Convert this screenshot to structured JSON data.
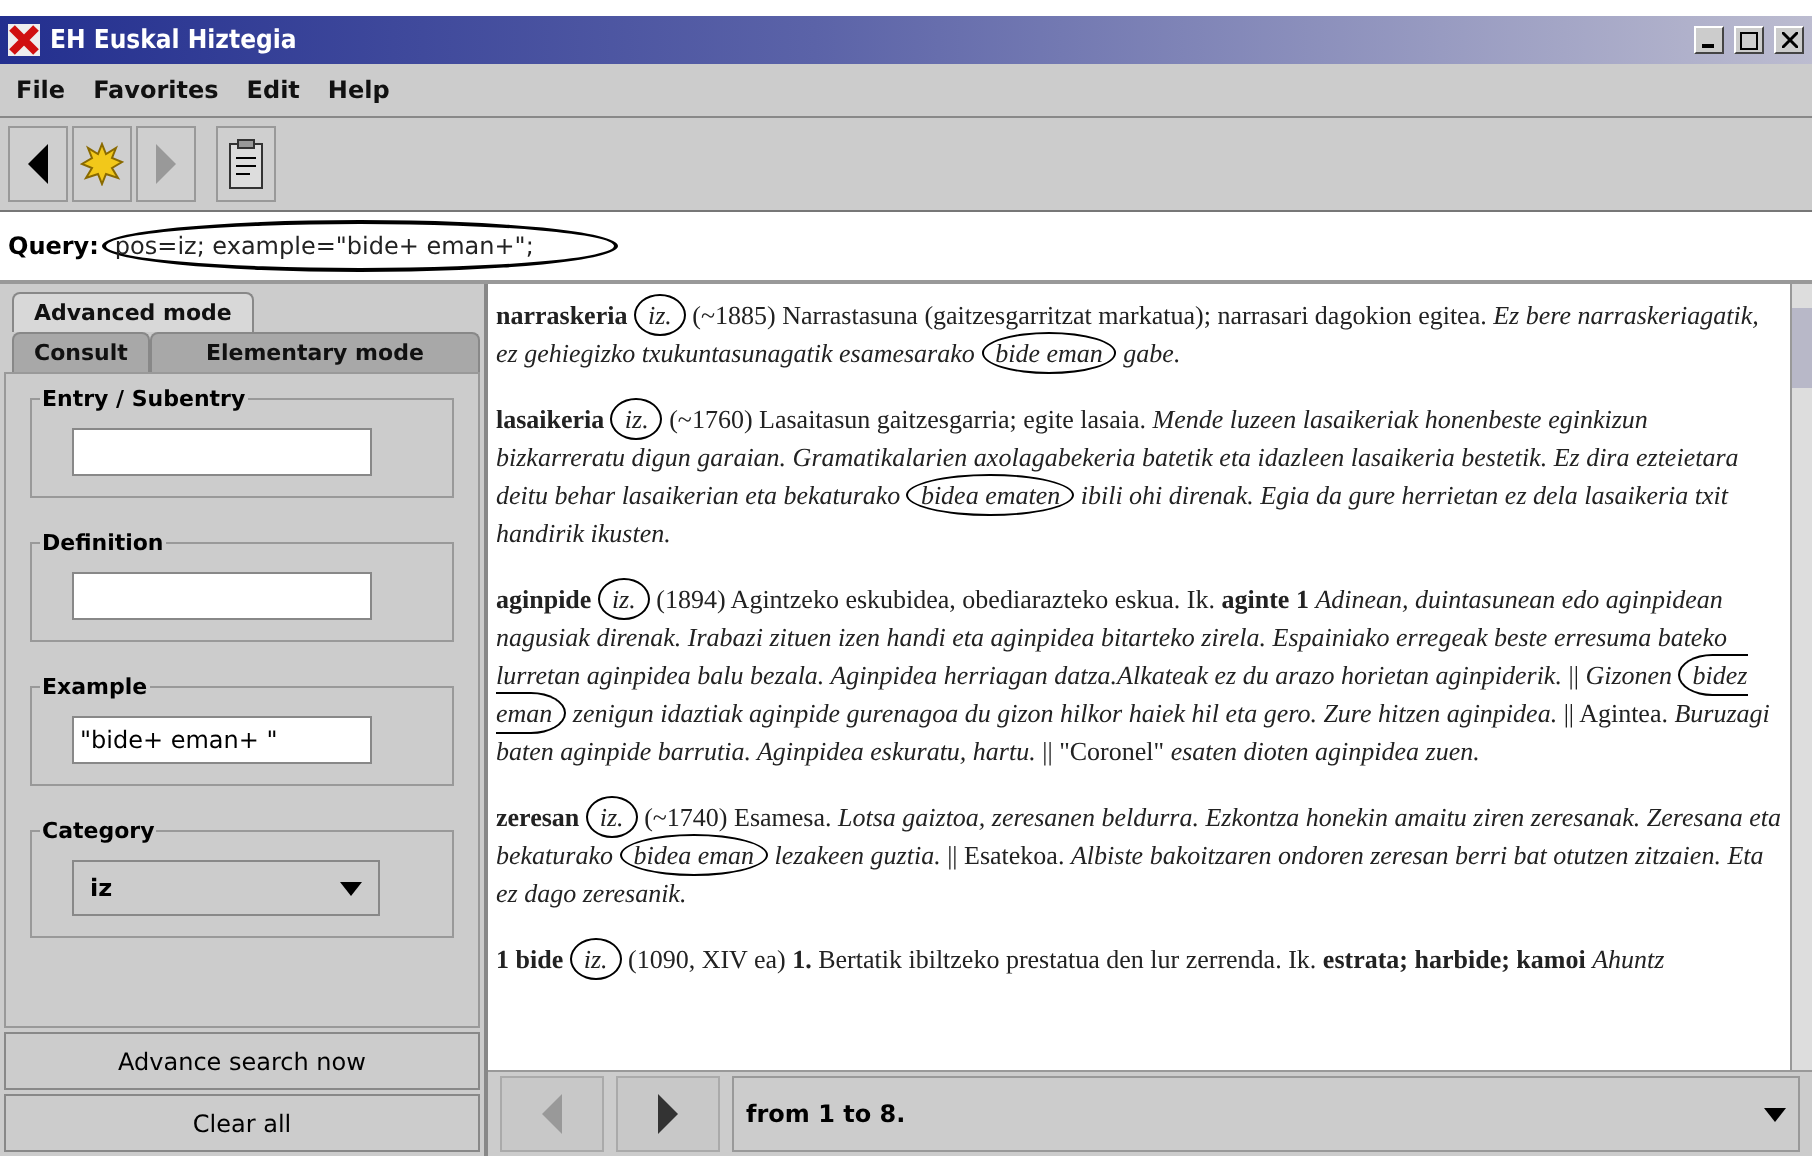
{
  "window": {
    "title": "EH Euskal Hiztegia"
  },
  "menu": [
    "File",
    "Favorites",
    "Edit",
    "Help"
  ],
  "toolbar": [
    {
      "kind": "back",
      "disabled": false
    },
    {
      "kind": "burst",
      "disabled": false
    },
    {
      "kind": "forward",
      "disabled": true
    },
    {
      "kind": "clipboard",
      "disabled": false
    }
  ],
  "query": {
    "label": "Query:",
    "value": "pos=iz; example=\"bide+ eman+\";",
    "circled": true
  },
  "tabs": [
    {
      "label": "Advanced mode",
      "selected": true
    },
    {
      "label": "Consult",
      "selected": false
    },
    {
      "label": "Elementary mode",
      "selected": false
    }
  ],
  "fields": [
    {
      "kind": "text",
      "label": "Entry / Subentry"
    },
    {
      "kind": "text",
      "label": "Definition"
    },
    {
      "kind": "text",
      "label": "Example",
      "value": "\"bide+ eman+ \""
    },
    {
      "kind": "select",
      "label": "Category",
      "value": "iz"
    }
  ],
  "buttons": [
    "Advance search now",
    "Clear all"
  ],
  "entries": [
    [
      {
        "kind": "bold",
        "t": "narraskeria"
      },
      {
        "kind": "italic",
        "t": "iz.",
        "circled": true
      },
      {
        "kind": "plain",
        "t": "(~1885) Narrastasuna (gaitzesgarritzat markatua); narrasari dagokion egitea."
      },
      {
        "kind": "italic",
        "t": "Ez bere narraskeriagatik, ez gehiegizko txukuntasunagatik esamesarako"
      },
      {
        "kind": "italic",
        "t": "bide eman",
        "circled": true
      },
      {
        "kind": "italic",
        "t": "gabe."
      }
    ],
    [
      {
        "kind": "bold",
        "t": "lasaikeria"
      },
      {
        "kind": "italic",
        "t": "iz.",
        "circled": true
      },
      {
        "kind": "plain",
        "t": "(~1760) Lasaitasun gaitzesgarria; egite lasaia."
      },
      {
        "kind": "italic",
        "t": "Mende luzeen lasaikeriak honenbeste eginkizun bizkarreratu digun garaian. Gramatikalarien axolagabekeria batetik eta idazleen lasaikeria bestetik. Ez dira ezteietara deitu behar lasaikerian eta bekaturako"
      },
      {
        "kind": "italic",
        "t": "bidea ematen",
        "circled": true
      },
      {
        "kind": "italic",
        "t": "ibili ohi direnak. Egia da gure herrietan ez dela lasaikeria txit handirik ikusten."
      }
    ],
    [
      {
        "kind": "bold",
        "t": "aginpide"
      },
      {
        "kind": "italic",
        "t": "iz.",
        "circled": true
      },
      {
        "kind": "plain",
        "t": "(1894) Agintzeko eskubidea, obediarazteko eskua. Ik."
      },
      {
        "kind": "bold",
        "t": "aginte 1"
      },
      {
        "kind": "italic",
        "t": "Adinean, duintasunean edo aginpidean nagusiak direnak. Irabazi zituen izen handi eta aginpidea bitarteko zirela. Espainiako erregeak beste erresuma bateko lurretan aginpidea balu bezala. Aginpidea herriagan datza.Alkateak ez du arazo horietan aginpiderik."
      },
      {
        "kind": "plain",
        "t": "||"
      },
      {
        "kind": "italic",
        "t": "Gizonen"
      },
      {
        "kind": "italic",
        "t": "bidez eman",
        "circled": true
      },
      {
        "kind": "italic",
        "t": "zenigun idaztiak aginpide gurenagoa du gizon hilkor haiek hil eta gero. Zure hitzen aginpidea."
      },
      {
        "kind": "plain",
        "t": "|| Agintea."
      },
      {
        "kind": "italic",
        "t": "Buruzagi baten aginpide barrutia. Aginpidea eskuratu, hartu."
      },
      {
        "kind": "plain",
        "t": "|| \"Coronel\""
      },
      {
        "kind": "italic",
        "t": "esaten dioten aginpidea zuen."
      }
    ],
    [
      {
        "kind": "bold",
        "t": "zeresan"
      },
      {
        "kind": "italic",
        "t": "iz.",
        "circled": true
      },
      {
        "kind": "plain",
        "t": "(~1740) Esamesa."
      },
      {
        "kind": "italic",
        "t": "Lotsa gaiztoa, zeresanen beldurra. Ezkontza honekin amaitu ziren zeresanak. Zeresana eta bekaturako"
      },
      {
        "kind": "italic",
        "t": "bidea eman",
        "circled": true
      },
      {
        "kind": "italic",
        "t": "lezakeen guztia."
      },
      {
        "kind": "plain",
        "t": "|| Esatekoa."
      },
      {
        "kind": "italic",
        "t": "Albiste bakoitzaren ondoren zeresan berri bat otutzen zitzaien. Eta ez dago zeresanik."
      }
    ],
    [
      {
        "kind": "bold",
        "t": "1 bide"
      },
      {
        "kind": "italic",
        "t": "iz.",
        "circled": true
      },
      {
        "kind": "plain",
        "t": "(1090, XIV ea)"
      },
      {
        "kind": "bold",
        "t": "1."
      },
      {
        "kind": "plain",
        "t": "Bertatik ibiltzeko prestatua den lur zerrenda. Ik."
      },
      {
        "kind": "bold",
        "t": "estrata; harbide; kamoi"
      },
      {
        "kind": "italic",
        "t": "Ahuntz"
      }
    ]
  ],
  "pager": {
    "prev_disabled": true,
    "next_disabled": false,
    "range": "from 1 to 8."
  }
}
